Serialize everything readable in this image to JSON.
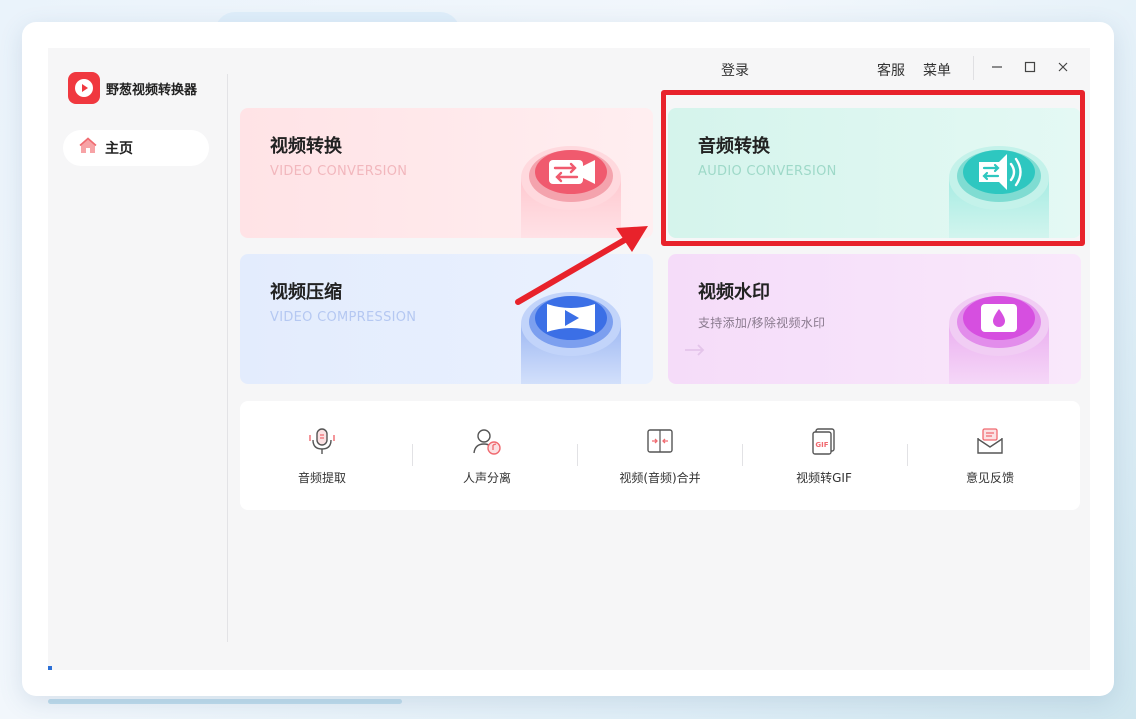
{
  "app": {
    "name": "野葱视频转换器",
    "logo_icon": "play-logo-icon"
  },
  "sidebar": {
    "items": [
      {
        "label": "主页",
        "icon": "home-icon",
        "active": true
      }
    ]
  },
  "topbar": {
    "login": "登录",
    "service": "客服",
    "menu": "菜单"
  },
  "features": [
    {
      "title": "视频转换",
      "subtitle": "VIDEO CONVERSION",
      "icon": "video-convert-icon",
      "color": "#f05a6e"
    },
    {
      "title": "音频转换",
      "subtitle": "AUDIO CONVERSION",
      "icon": "audio-convert-icon",
      "color": "#2ec7c0",
      "highlighted": true
    },
    {
      "title": "视频压缩",
      "subtitle": "VIDEO COMPRESSION",
      "icon": "video-compress-icon",
      "color": "#3b6fe6"
    },
    {
      "title": "视频水印",
      "subtitle": "支持添加/移除视频水印",
      "icon": "watermark-icon",
      "color": "#d64fe0"
    }
  ],
  "tools": [
    {
      "label": "音频提取",
      "icon": "microphone-icon"
    },
    {
      "label": "人声分离",
      "icon": "voice-separation-icon"
    },
    {
      "label": "视频(音频)合并",
      "icon": "merge-icon"
    },
    {
      "label": "视频转GIF",
      "icon": "gif-icon"
    },
    {
      "label": "意见反馈",
      "icon": "feedback-mail-icon"
    }
  ],
  "colors": {
    "accent_red": "#f0383f",
    "highlight_border": "#e8222b",
    "card_video": "#ffe6e9",
    "card_audio": "#d9f6ef",
    "card_compress": "#e4edfd",
    "card_watermark": "#f6dff8"
  }
}
